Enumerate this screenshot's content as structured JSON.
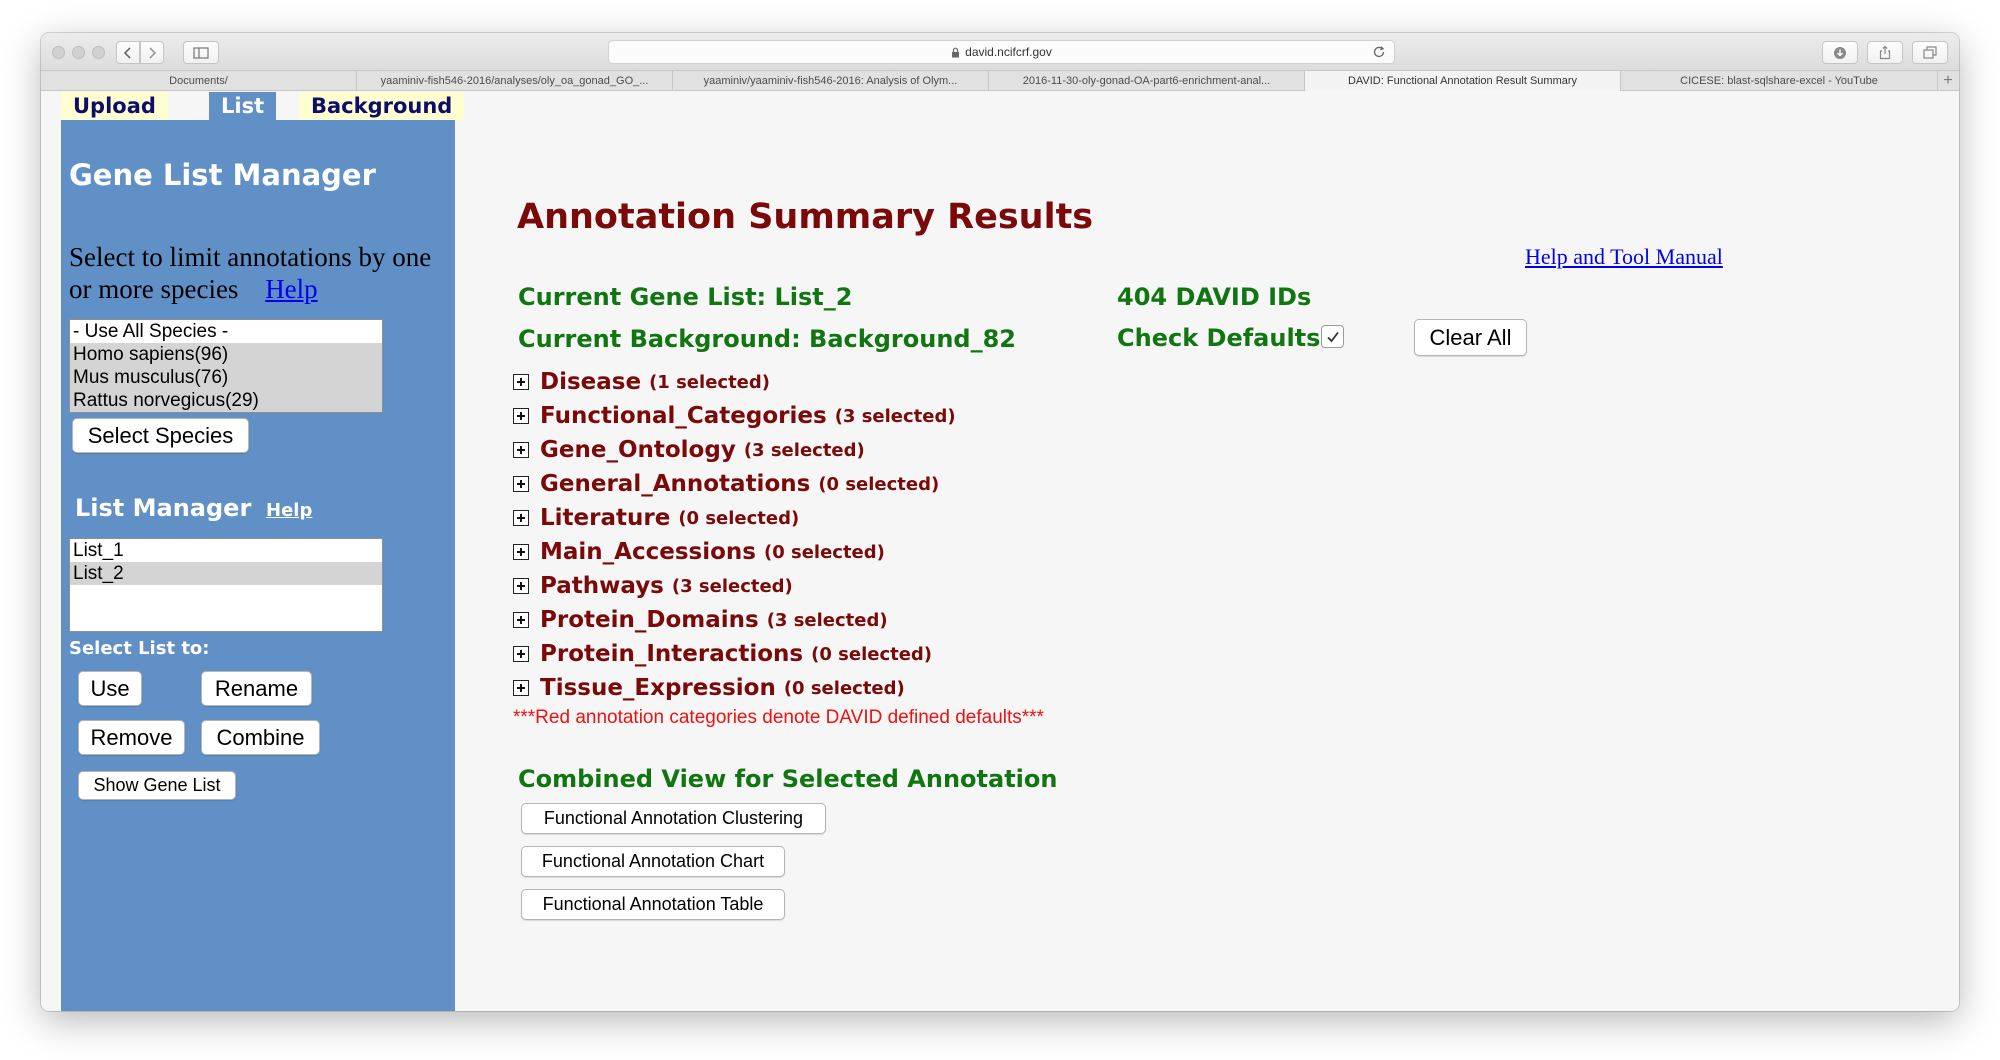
{
  "browser": {
    "url": "david.ncifcrf.gov",
    "tabs": [
      {
        "label": "Documents/"
      },
      {
        "label": "yaaminiv-fish546-2016/analyses/oly_oa_gonad_GO_..."
      },
      {
        "label": "yaaminiv/yaaminiv-fish546-2016: Analysis of Olym..."
      },
      {
        "label": "2016-11-30-oly-gonad-OA-part6-enrichment-anal..."
      },
      {
        "label": "DAVID: Functional Annotation Result Summary"
      },
      {
        "label": "CICESE: blast-sqlshare-excel - YouTube"
      }
    ],
    "active_tab_index": 4
  },
  "nav_tabs": [
    {
      "label": "Upload"
    },
    {
      "label": "List"
    },
    {
      "label": "Background"
    }
  ],
  "sidebar": {
    "title": "Gene List Manager",
    "species_desc": "Select to limit annotations by one or more species",
    "species_help": "Help",
    "species_options": [
      {
        "label": "- Use All Species -",
        "selected": false
      },
      {
        "label": "Homo sapiens(96)",
        "selected": true
      },
      {
        "label": "Mus musculus(76)",
        "selected": true
      },
      {
        "label": "Rattus norvegicus(29)",
        "selected": true
      }
    ],
    "select_species_button": "Select Species",
    "list_manager_title": "List Manager",
    "list_manager_help": "Help",
    "lists": [
      {
        "label": "List_1",
        "selected": false
      },
      {
        "label": "List_2",
        "selected": true
      }
    ],
    "select_list_label": "Select List to:",
    "buttons": {
      "use": "Use",
      "rename": "Rename",
      "remove": "Remove",
      "combine": "Combine",
      "show_gene_list": "Show Gene List"
    }
  },
  "main": {
    "title": "Annotation Summary Results",
    "help_link": "Help and Tool Manual",
    "current_gene_list": "Current Gene List: List_2",
    "david_ids": "404 DAVID IDs",
    "current_background": "Current Background: Background_82",
    "check_defaults_label": "Check Defaults",
    "check_defaults_checked": true,
    "clear_all_button": "Clear All",
    "categories": [
      {
        "name": "Disease",
        "count": "(1 selected)"
      },
      {
        "name": "Functional_Categories",
        "count": "(3 selected)"
      },
      {
        "name": "Gene_Ontology",
        "count": "(3 selected)"
      },
      {
        "name": "General_Annotations",
        "count": "(0 selected)"
      },
      {
        "name": "Literature",
        "count": "(0 selected)"
      },
      {
        "name": "Main_Accessions",
        "count": "(0 selected)"
      },
      {
        "name": "Pathways",
        "count": "(3 selected)"
      },
      {
        "name": "Protein_Domains",
        "count": "(3 selected)"
      },
      {
        "name": "Protein_Interactions",
        "count": "(0 selected)"
      },
      {
        "name": "Tissue_Expression",
        "count": "(0 selected)"
      }
    ],
    "red_note": "***Red annotation categories denote DAVID defined defaults***",
    "combined_view_title": "Combined View for Selected Annotation",
    "combined_buttons": {
      "clustering": "Functional Annotation Clustering",
      "chart": "Functional Annotation Chart",
      "table": "Functional Annotation Table"
    }
  },
  "colors": {
    "sidebar_bg": "#6190c7",
    "title_red": "#7a0a0a",
    "label_green": "#117511",
    "note_red": "#ee1111",
    "tab_bg": "#fffed0"
  }
}
